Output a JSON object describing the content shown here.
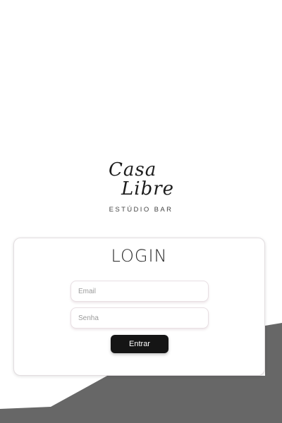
{
  "logo": {
    "line1": "Casa",
    "line2": "Libre",
    "subtitle": "ESTÚDIO BAR"
  },
  "login_card": {
    "title": "LOGIN",
    "email_placeholder": "Email",
    "password_placeholder": "Senha",
    "submit_label": "Entrar"
  },
  "colors": {
    "background": "#ffffff",
    "decor_shape": "#676767",
    "button": "#151515",
    "button_text": "#ffffff"
  }
}
